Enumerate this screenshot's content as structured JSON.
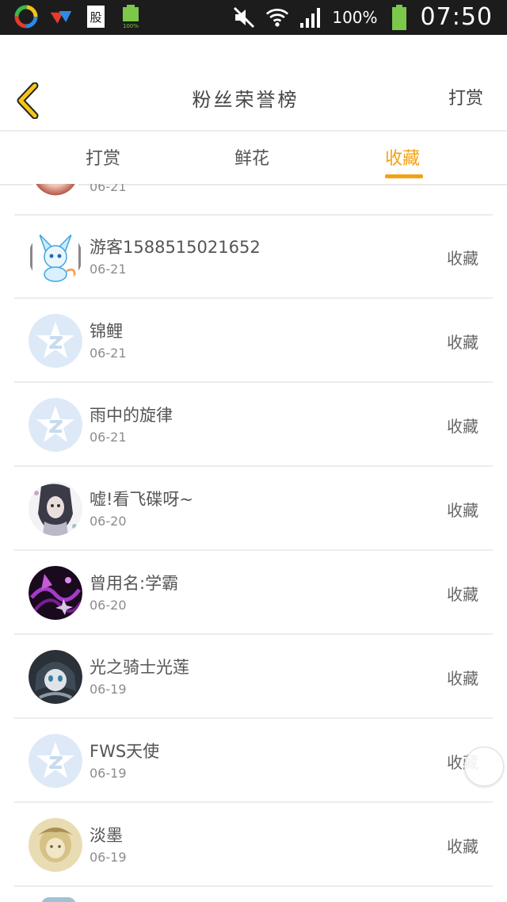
{
  "status_bar": {
    "battery_percent": "100%",
    "time": "07:50",
    "notification_battery_label": "100%",
    "notification_icons": [
      "app-icon-1",
      "app-icon-2",
      "stock-icon",
      "battery-small-icon"
    ],
    "right_icons": [
      "mute-icon",
      "wifi-icon",
      "signal-icon",
      "battery-icon"
    ]
  },
  "header": {
    "title": "粉丝荣誉榜",
    "action_label": "打赏",
    "back_icon": "chevron-left-icon"
  },
  "tabs": [
    {
      "label": "打赏",
      "active": false
    },
    {
      "label": "鲜花",
      "active": false
    },
    {
      "label": "收藏",
      "active": true
    }
  ],
  "accent_color": "#f2a213",
  "partial_item": {
    "date": "06-21"
  },
  "items": [
    {
      "name": "游客15885150216​52",
      "date": "06-21",
      "action": "收藏",
      "avatar": "mascot-avatar"
    },
    {
      "name": "锦鲤",
      "date": "06-21",
      "action": "收藏",
      "avatar": "default-avatar"
    },
    {
      "name": "雨中的旋律",
      "date": "06-21",
      "action": "收藏",
      "avatar": "default-avatar"
    },
    {
      "name": "嘘!看飞碟呀~",
      "date": "06-20",
      "action": "收藏",
      "avatar": "anime-avatar"
    },
    {
      "name": "曾用名:学霸",
      "date": "06-20",
      "action": "收藏",
      "avatar": "purple-avatar"
    },
    {
      "name": "光之骑士光莲",
      "date": "06-19",
      "action": "收藏",
      "avatar": "dark-anime-avatar"
    },
    {
      "name": "FWS天使",
      "date": "06-19",
      "action": "收藏",
      "avatar": "default-avatar"
    },
    {
      "name": "淡墨",
      "date": "06-19",
      "action": "收藏",
      "avatar": "sepia-avatar"
    }
  ]
}
